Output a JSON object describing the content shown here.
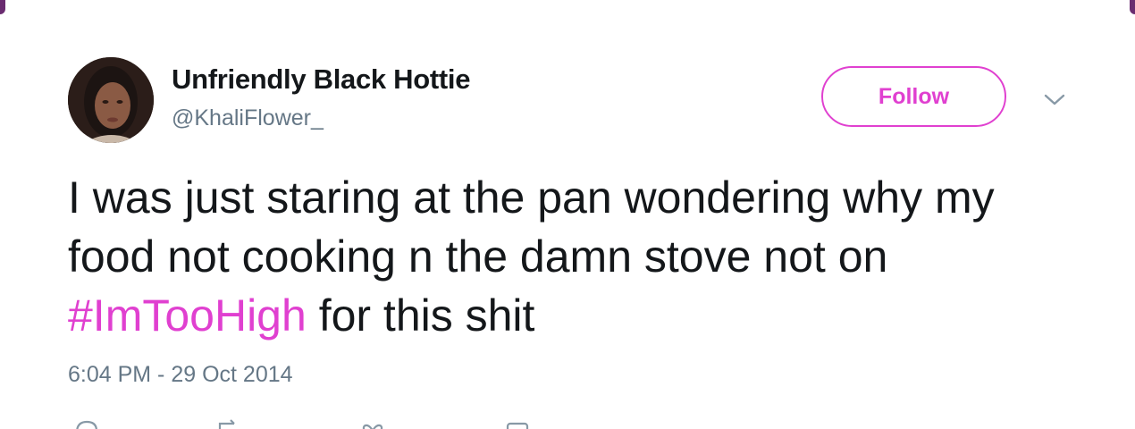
{
  "tweet": {
    "author": {
      "display_name": "Unfriendly Black Hottie",
      "handle": "@KhaliFlower_"
    },
    "follow_label": "Follow",
    "text_before": "I was just staring at the pan wondering why my food not cooking n the damn stove not on ",
    "hashtag": "#ImTooHigh",
    "text_after": " for this shit",
    "timestamp": "6:04 PM - 29 Oct 2014"
  },
  "icons": {
    "menu": "chevron-down-icon",
    "actions": [
      "reply-icon",
      "retweet-icon",
      "like-icon",
      "message-icon"
    ]
  },
  "colors": {
    "accent": "#e040d0",
    "text": "#14171a",
    "secondary_text": "#657786",
    "frame_edge": "#6a2c70"
  }
}
